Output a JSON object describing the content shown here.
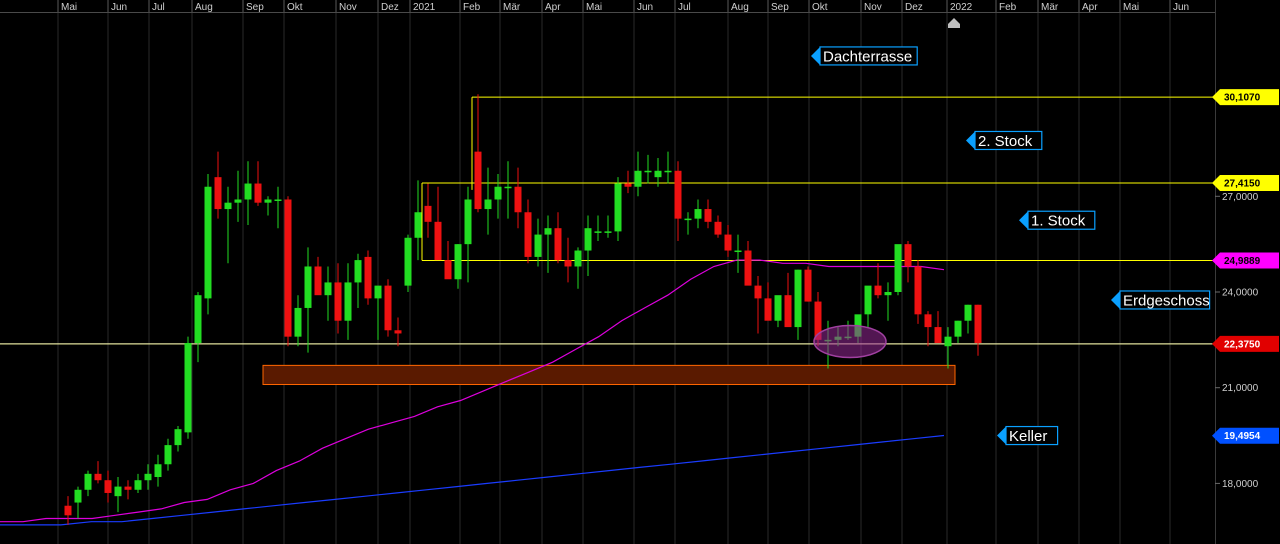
{
  "chart_data": {
    "type": "candlestick",
    "x_axis": {
      "labels": [
        "Mai",
        "Jun",
        "Jul",
        "Aug",
        "Sep",
        "Okt",
        "Nov",
        "Dez",
        "2021",
        "Feb",
        "Mär",
        "Apr",
        "Mai",
        "Jun",
        "Jul",
        "Aug",
        "Sep",
        "Okt",
        "Nov",
        "Dez",
        "2022",
        "Feb",
        "Mär",
        "Apr",
        "Mai",
        "Jun"
      ]
    },
    "y_axis": {
      "tick_labels": [
        "27,0000",
        "24,0000",
        "21,0000",
        "18,0000"
      ],
      "ticks": [
        27,
        24,
        21,
        18
      ],
      "range": [
        16.5,
        32.5
      ]
    },
    "series": [
      {
        "values": [
          [
            17.3,
            17.6,
            16.7,
            17.0
          ],
          [
            17.4,
            17.9,
            16.9,
            17.8
          ],
          [
            17.8,
            18.4,
            17.6,
            18.3
          ],
          [
            18.3,
            18.7,
            18.0,
            18.1
          ],
          [
            18.1,
            18.4,
            17.4,
            17.7
          ],
          [
            17.6,
            18.2,
            17.1,
            17.9
          ],
          [
            17.9,
            18.1,
            17.5,
            17.8
          ],
          [
            17.8,
            18.3,
            17.7,
            18.1
          ],
          [
            18.1,
            18.6,
            17.8,
            18.3
          ],
          [
            18.2,
            18.9,
            17.9,
            18.6
          ],
          [
            18.6,
            19.4,
            18.4,
            19.2
          ],
          [
            19.2,
            19.8,
            19.0,
            19.7
          ],
          [
            19.6,
            22.6,
            19.4,
            22.4
          ],
          [
            22.4,
            24.0,
            21.8,
            23.9
          ],
          [
            23.8,
            27.7,
            23.3,
            27.3
          ],
          [
            27.6,
            28.4,
            26.3,
            26.6
          ],
          [
            26.6,
            27.3,
            24.9,
            26.8
          ],
          [
            26.8,
            27.8,
            26.2,
            26.9
          ],
          [
            26.9,
            28.1,
            26.1,
            27.4
          ],
          [
            27.4,
            28.1,
            26.7,
            26.8
          ],
          [
            26.8,
            27.0,
            26.4,
            26.9
          ],
          [
            26.9,
            27.3,
            26.0,
            26.9
          ],
          [
            26.9,
            27.0,
            22.3,
            22.6
          ],
          [
            22.6,
            23.9,
            22.3,
            23.5
          ],
          [
            23.5,
            25.4,
            22.1,
            24.8
          ],
          [
            24.8,
            25.1,
            24.0,
            23.9
          ],
          [
            23.9,
            24.8,
            23.1,
            24.3
          ],
          [
            24.3,
            24.9,
            22.7,
            23.1
          ],
          [
            23.1,
            24.9,
            22.5,
            24.3
          ],
          [
            24.3,
            25.2,
            23.5,
            25.0
          ],
          [
            25.1,
            25.3,
            23.6,
            23.8
          ],
          [
            23.8,
            24.0,
            22.5,
            24.2
          ],
          [
            24.2,
            24.4,
            22.6,
            22.8
          ],
          [
            22.8,
            23.2,
            22.3,
            22.7
          ],
          [
            24.2,
            25.8,
            24.0,
            25.7
          ],
          [
            25.7,
            27.5,
            25.0,
            26.5
          ],
          [
            26.7,
            27.4,
            25.7,
            26.2
          ],
          [
            26.2,
            27.3,
            25.5,
            25.0
          ],
          [
            25.0,
            25.6,
            24.8,
            24.4
          ],
          [
            24.4,
            25.5,
            24.1,
            25.5
          ],
          [
            25.5,
            27.3,
            24.3,
            26.9
          ],
          [
            28.4,
            30.2,
            26.5,
            26.6
          ],
          [
            26.6,
            27.9,
            25.8,
            26.9
          ],
          [
            26.9,
            27.7,
            26.3,
            27.3
          ],
          [
            27.3,
            28.1,
            26.3,
            27.3
          ],
          [
            27.3,
            27.9,
            26.0,
            26.5
          ],
          [
            26.5,
            26.9,
            24.9,
            25.1
          ],
          [
            25.1,
            26.3,
            24.8,
            25.8
          ],
          [
            25.8,
            26.4,
            24.6,
            26.0
          ],
          [
            26.0,
            26.5,
            24.9,
            25.0
          ],
          [
            25.0,
            25.7,
            24.3,
            24.8
          ],
          [
            24.8,
            25.4,
            24.1,
            25.3
          ],
          [
            25.3,
            26.4,
            24.5,
            26.0
          ],
          [
            25.9,
            26.4,
            25.6,
            25.9
          ],
          [
            25.9,
            26.4,
            25.7,
            25.9
          ],
          [
            25.9,
            27.6,
            25.6,
            27.4
          ],
          [
            27.4,
            27.8,
            27.1,
            27.3
          ],
          [
            27.3,
            28.4,
            27.0,
            27.8
          ],
          [
            27.8,
            28.3,
            27.4,
            27.8
          ],
          [
            27.6,
            28.2,
            27.3,
            27.8
          ],
          [
            27.8,
            28.4,
            27.4,
            27.8
          ],
          [
            27.8,
            28.1,
            25.6,
            26.3
          ],
          [
            26.3,
            26.5,
            25.8,
            26.3
          ],
          [
            26.3,
            26.9,
            26.0,
            26.6
          ],
          [
            26.6,
            26.9,
            26.0,
            26.2
          ],
          [
            26.2,
            26.4,
            25.7,
            25.8
          ],
          [
            25.8,
            26.1,
            25.1,
            25.3
          ],
          [
            25.3,
            25.8,
            24.6,
            25.3
          ],
          [
            25.3,
            25.6,
            24.6,
            24.2
          ],
          [
            24.2,
            24.5,
            22.7,
            23.8
          ],
          [
            23.8,
            24.3,
            23.3,
            23.1
          ],
          [
            23.1,
            23.8,
            22.9,
            23.9
          ],
          [
            23.9,
            24.6,
            23.3,
            22.9
          ],
          [
            22.9,
            24.7,
            22.5,
            24.7
          ],
          [
            24.7,
            24.8,
            23.7,
            23.7
          ],
          [
            23.7,
            24.0,
            22.3,
            22.5
          ],
          [
            22.5,
            23.1,
            21.6,
            22.5
          ],
          [
            22.5,
            22.9,
            22.3,
            22.6
          ],
          [
            22.6,
            23.1,
            22.5,
            22.6
          ],
          [
            22.6,
            23.0,
            22.4,
            23.3
          ],
          [
            23.3,
            24.0,
            22.9,
            24.2
          ],
          [
            24.2,
            24.9,
            23.8,
            23.9
          ],
          [
            23.9,
            24.3,
            23.1,
            24.0
          ],
          [
            24.0,
            25.4,
            23.9,
            25.5
          ],
          [
            25.5,
            25.6,
            24.3,
            24.8
          ],
          [
            24.8,
            25.0,
            23.0,
            23.3
          ],
          [
            23.3,
            23.4,
            22.3,
            22.9
          ],
          [
            22.9,
            23.4,
            22.4,
            22.4
          ],
          [
            22.3,
            22.9,
            21.6,
            22.6
          ],
          [
            22.6,
            23.1,
            22.4,
            23.1
          ],
          [
            23.1,
            23.6,
            22.7,
            23.6
          ],
          [
            23.6,
            23.6,
            22.0,
            22.4
          ]
        ]
      },
      {
        "values": [
          16.8,
          16.8,
          16.9,
          16.9,
          16.9,
          17.0,
          17.1,
          17.2,
          17.4,
          17.5,
          17.8,
          18.0,
          18.4,
          18.7,
          19.1,
          19.4,
          19.7,
          19.9,
          20.1,
          20.4,
          20.6,
          20.9,
          21.2,
          21.5,
          21.8,
          22.2,
          22.6,
          23.1,
          23.5,
          23.9,
          24.4,
          24.8,
          25.0,
          25.0,
          24.9,
          24.9,
          24.8,
          24.8,
          24.8,
          24.8,
          24.8,
          24.7
        ]
      },
      {
        "values": [
          16.7,
          16.7,
          16.7,
          16.8,
          16.8,
          16.9,
          17.0,
          17.1,
          17.2,
          17.3,
          17.4,
          17.5,
          17.6,
          17.7,
          17.8,
          17.9,
          18.0,
          18.1,
          18.2,
          18.3,
          18.4,
          18.5,
          18.6,
          18.7,
          18.8,
          18.9,
          19.0,
          19.1,
          19.2,
          19.3,
          19.4,
          19.5
        ]
      }
    ],
    "price_tags": [
      {
        "value": 30.107,
        "label": "30,1070",
        "bg": "#ffff00",
        "fg": "#000000"
      },
      {
        "value": 27.415,
        "label": "27,4150",
        "bg": "#ffff00",
        "fg": "#000000"
      },
      {
        "value": 24.9889,
        "label": "24,9889",
        "bg": "#ff00ff",
        "fg": "#000000"
      },
      {
        "value": 22.375,
        "label": "22,3750",
        "bg": "#e10000",
        "fg": "#ffffff"
      },
      {
        "value": 19.4954,
        "label": "19,4954",
        "bg": "#0050ff",
        "fg": "#ffffff"
      }
    ],
    "floor_labels": [
      {
        "text": "Dachterrasse",
        "value": 31.4
      },
      {
        "text": "2. Stock",
        "value": 28.75
      },
      {
        "text": "1. Stock",
        "value": 26.25
      },
      {
        "text": "Erdgeschoss",
        "value": 23.75
      },
      {
        "text": "Keller",
        "value": 19.5
      }
    ],
    "horizontal_levels": [
      {
        "value": 30.107,
        "color": "#ffff00",
        "from_bar": 41
      },
      {
        "value": 27.415,
        "color": "#ffff00",
        "from_bar": 36
      },
      {
        "value": 24.9889,
        "color": "#ffff00",
        "from_bar": 36
      },
      {
        "value": 22.375,
        "color": "#ffff00",
        "from_bar": -5
      }
    ],
    "support_zone": {
      "low": 21.1,
      "high": 21.7,
      "color": "#5a1a00",
      "border": "#ff6600"
    },
    "highlight_ellipse": {
      "bar": 77,
      "value": 22.45,
      "color": "#a040a0"
    },
    "colors": {
      "up": "#22dd22",
      "down": "#ee1111",
      "ma_magenta": "#dd00dd",
      "ma_blue": "#1a3cff",
      "background": "#000000",
      "grid": "#2a2a2a",
      "label_box": "#0aa0ff"
    }
  }
}
